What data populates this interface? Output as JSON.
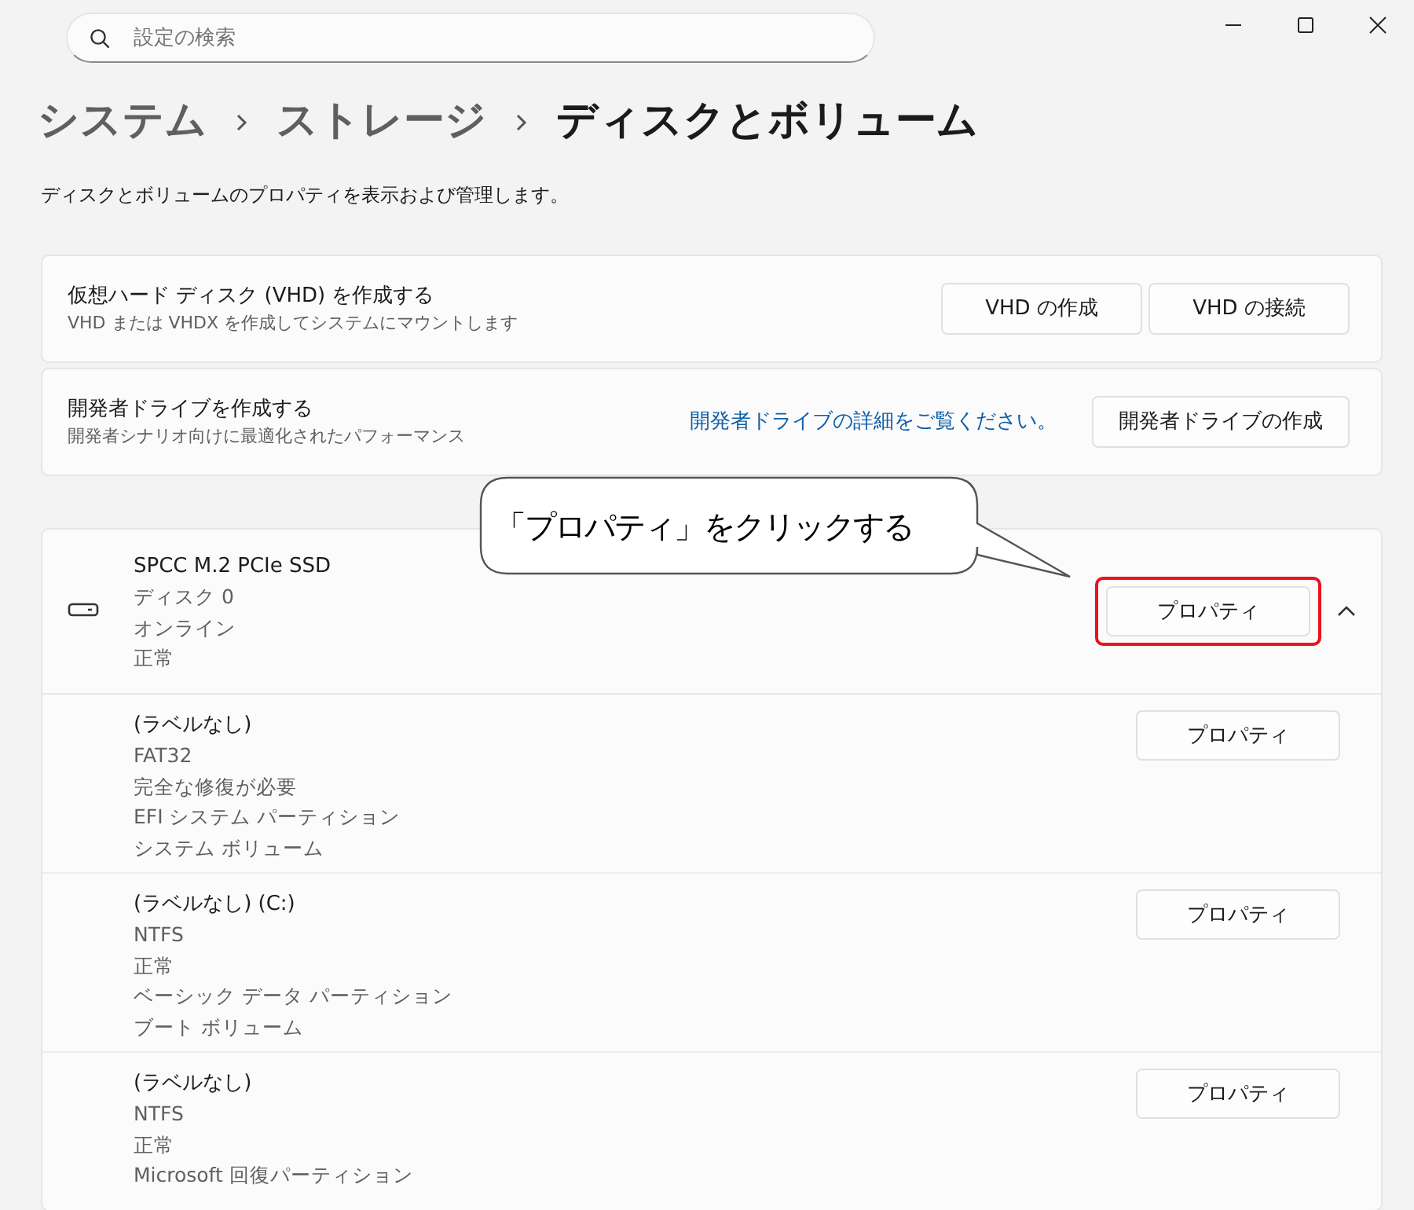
{
  "search": {
    "placeholder": "設定の検索"
  },
  "breadcrumb": [
    {
      "label": "システム",
      "selected": false
    },
    {
      "label": "ストレージ",
      "selected": false
    },
    {
      "label": "ディスクとボリューム",
      "selected": true
    }
  ],
  "description": "ディスクとボリュームのプロパティを表示および管理します。",
  "actions": [
    {
      "title": "仮想ハード ディスク (VHD) を作成する",
      "subtitle": "VHD または VHDX を作成してシステムにマウントします",
      "buttons": [
        "VHD の作成",
        "VHD の接続"
      ]
    },
    {
      "title": "開発者ドライブを作成する",
      "subtitle": "開発者シナリオ向けに最適化されたパフォーマンス",
      "link": "開発者ドライブの詳細をご覧ください。",
      "buttons": [
        "開発者ドライブの作成"
      ]
    }
  ],
  "disk": {
    "name": "SPCC M.2 PCIe SSD",
    "details": [
      "ディスク 0",
      "オンライン",
      "正常"
    ],
    "button": "プロパティ",
    "highlighted": true,
    "expanded": true,
    "volumes": [
      {
        "name": "(ラベルなし)",
        "details": [
          "FAT32",
          "完全な修復が必要",
          "EFI システム パーティション",
          "システム ボリューム"
        ],
        "button": "プロパティ"
      },
      {
        "name": "(ラベルなし) (C:)",
        "details": [
          "NTFS",
          "正常",
          "ベーシック データ パーティション",
          "ブート ボリューム"
        ],
        "button": "プロパティ"
      },
      {
        "name": "(ラベルなし)",
        "details": [
          "NTFS",
          "正常",
          "Microsoft 回復パーティション"
        ],
        "button": "プロパティ"
      }
    ]
  },
  "callout": {
    "text": "「プロパティ」をクリックする"
  }
}
